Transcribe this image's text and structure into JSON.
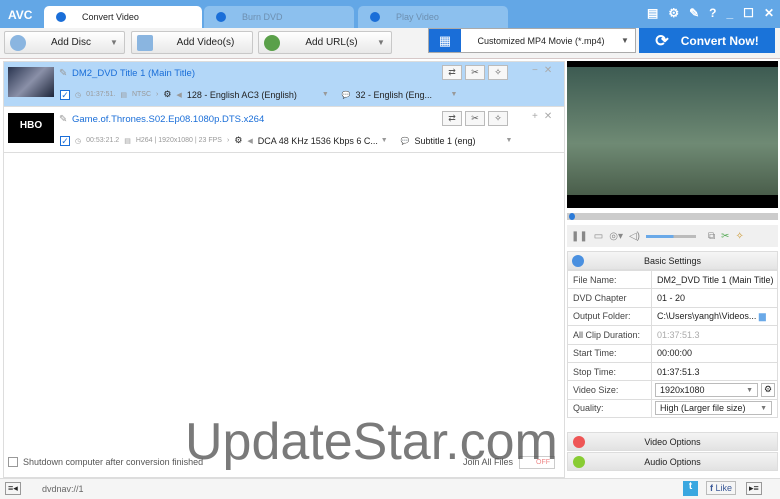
{
  "app": {
    "logo": "AVC",
    "tabs": [
      "Convert Video",
      "Burn DVD",
      "Play Video"
    ],
    "window_controls": [
      "menu",
      "settings",
      "tools",
      "?",
      "minimize",
      "maximize",
      "close"
    ]
  },
  "toolbar": {
    "add_disc": "Add Disc",
    "add_videos": "Add Video(s)",
    "add_urls": "Add URL(s)",
    "profile": "Customized MP4 Movie (*.mp4)",
    "convert": "Convert Now!"
  },
  "files": [
    {
      "title": "DM2_DVD Title 1 (Main Title)",
      "duration": "01:37:51.",
      "video": "NTSC",
      "audio": "128 - English AC3 (English)",
      "subtitle": "32 - English (Eng..."
    },
    {
      "title": "Game.of.Thrones.S02.Ep08.1080p.DTS.x264",
      "duration": "00:53:21.2",
      "video": "H264 | 1920x1080 | 23 FPS",
      "audio": "DCA 48 KHz 1536 Kbps 6 C...",
      "subtitle": "Subtitle 1 (eng)",
      "thumb_text": "HBO"
    }
  ],
  "bottom": {
    "shutdown": "Shutdown computer after conversion finished",
    "join": "Join All Files",
    "join_state": "OFF"
  },
  "settings": {
    "header": "Basic Settings",
    "rows": [
      {
        "k": "File Name:",
        "v": "DM2_DVD Title 1 (Main Title)"
      },
      {
        "k": "DVD Chapter",
        "v": "01 - 20"
      },
      {
        "k": "Output Folder:",
        "v": "C:\\Users\\yangh\\Videos..."
      },
      {
        "k": "All Clip Duration:",
        "v": "01:37:51.3"
      },
      {
        "k": "Start Time:",
        "v": "00:00:00"
      },
      {
        "k": "Stop Time:",
        "v": "01:37:51.3"
      },
      {
        "k": "Video Size:",
        "v": "1920x1080"
      },
      {
        "k": "Quality:",
        "v": "High (Larger file size)"
      }
    ],
    "video_options": "Video Options",
    "audio_options": "Audio Options"
  },
  "player": {
    "volume": 0.55,
    "position": 0.01
  },
  "status": {
    "path": "dvdnav://1",
    "like": "Like"
  },
  "watermark": "UpdateStar.com"
}
